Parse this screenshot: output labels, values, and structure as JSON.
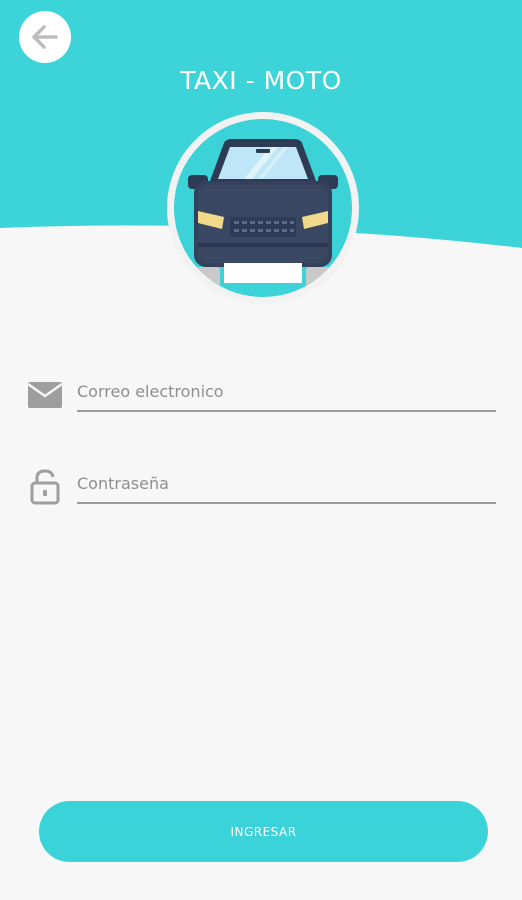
{
  "header": {
    "title": "TAXI - MOTO",
    "back_icon": "arrow-left-icon",
    "color": "#3cd4d9"
  },
  "avatar": {
    "icon": "car-icon"
  },
  "form": {
    "email": {
      "placeholder": "Correo electronico",
      "value": "",
      "icon": "mail-icon"
    },
    "password": {
      "placeholder": "Contraseña",
      "value": "",
      "icon": "lock-icon"
    }
  },
  "actions": {
    "login_label": "INGRESAR",
    "button_color": "#3bd3da"
  }
}
